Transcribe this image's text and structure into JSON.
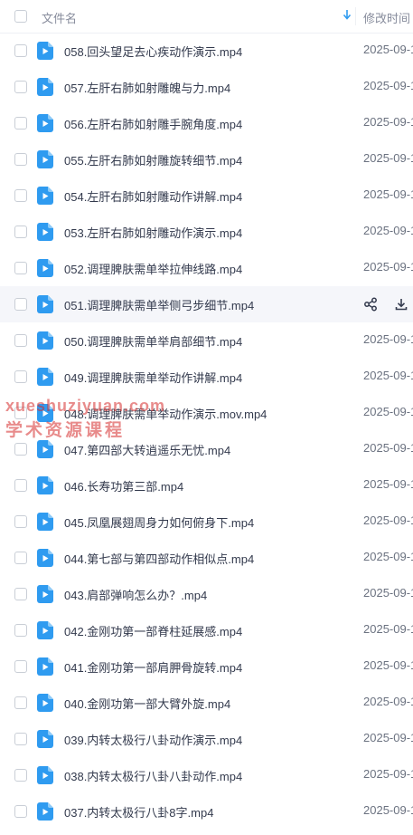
{
  "header": {
    "name_column": "文件名",
    "mtime_column": "修改时间",
    "sort_icon": "arrow-down-icon"
  },
  "files": [
    {
      "name": "058.回头望足去心疾动作演示.mp4",
      "date": "2025-09-1"
    },
    {
      "name": "057.左肝右肺如射雕魄与力.mp4",
      "date": "2025-09-1"
    },
    {
      "name": "056.左肝右肺如射雕手腕角度.mp4",
      "date": "2025-09-1"
    },
    {
      "name": "055.左肝右肺如射雕旋转细节.mp4",
      "date": "2025-09-1"
    },
    {
      "name": "054.左肝右肺如射雕动作讲解.mp4",
      "date": "2025-09-1"
    },
    {
      "name": "053.左肝右肺如射雕动作演示.mp4",
      "date": "2025-09-1"
    },
    {
      "name": "052.调理脾肤需单举拉伸线路.mp4",
      "date": "2025-09-1"
    },
    {
      "name": "051.调理脾肤需单举侧弓步细节.mp4",
      "date": ""
    },
    {
      "name": "050.调理脾肤需单举肩部细节.mp4",
      "date": "2025-09-1"
    },
    {
      "name": "049.调理脾肤需单举动作讲解.mp4",
      "date": "2025-09-1"
    },
    {
      "name": "048.调理脾肤需单举动作演示.mov.mp4",
      "date": "2025-09-1"
    },
    {
      "name": "047.第四部大转逍遥乐无忧.mp4",
      "date": "2025-09-1"
    },
    {
      "name": "046.长寿功第三部.mp4",
      "date": "2025-09-1"
    },
    {
      "name": "045.凤凰展翅周身力如何俯身下.mp4",
      "date": "2025-09-1"
    },
    {
      "name": "044.第七部与第四部动作相似点.mp4",
      "date": "2025-09-1"
    },
    {
      "name": "043.肩部弹响怎么办？.mp4",
      "date": "2025-09-1"
    },
    {
      "name": "042.金刚功第一部脊柱延展感.mp4",
      "date": "2025-09-1"
    },
    {
      "name": "041.金刚功第一部肩胛骨旋转.mp4",
      "date": "2025-09-1"
    },
    {
      "name": "040.金刚功第一部大臂外旋.mp4",
      "date": "2025-09-1"
    },
    {
      "name": "039.内转太极行八卦动作演示.mp4",
      "date": "2025-09-1"
    },
    {
      "name": "038.内转太极行八卦八卦动作.mp4",
      "date": "2025-09-1"
    },
    {
      "name": "037.内转太极行八卦8字.mp4",
      "date": "2025-09-1"
    }
  ],
  "hover_row_actions": {
    "share_icon": "share-icon",
    "download_icon": "download-icon"
  },
  "watermark": {
    "line1": "xueshuziyuan.com",
    "line2": "学术资源课程"
  },
  "colors": {
    "file_icon": "#2f9bf0",
    "hover_row": "#f5f6fa",
    "watermark": "#d62c2c",
    "sort_arrow": "#2f9bf0"
  }
}
